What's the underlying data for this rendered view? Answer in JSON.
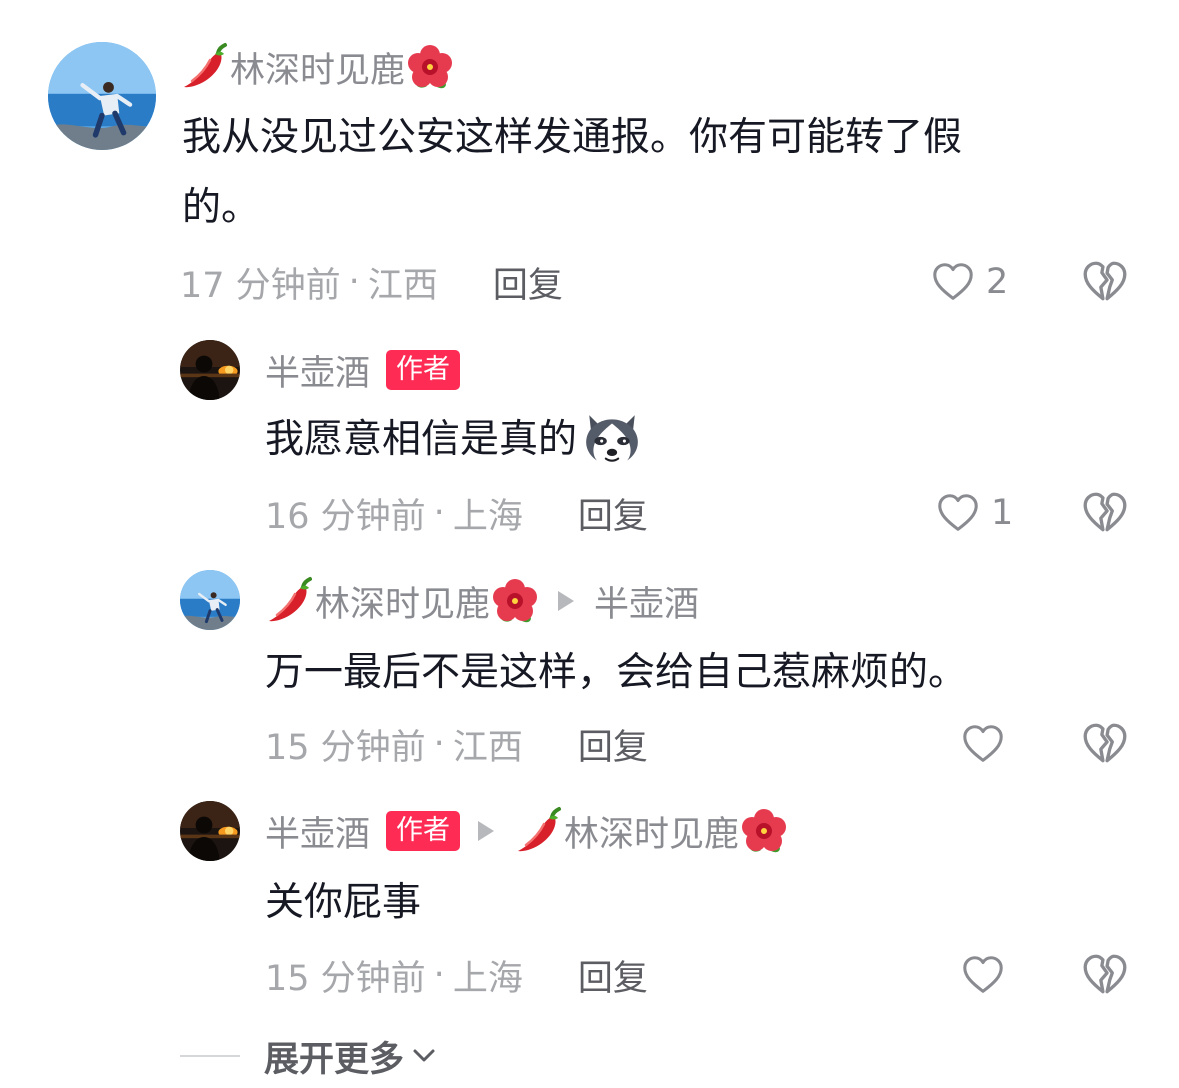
{
  "colors": {
    "accent": "#fe2c55",
    "text_primary": "#161823",
    "text_secondary": "#8a8b91",
    "text_meta": "#a6a7ab",
    "reply": "#5c5d63"
  },
  "comments": [
    {
      "user": "林深时见鹿",
      "prefix_icon": "chili-pepper-emoji-icon",
      "suffix_icon": "hibiscus-flower-emoji-icon",
      "text": "我从没见过公安这样发通报。你有可能转了假\n的。",
      "time": "17 分钟前",
      "location": "江西",
      "reply_label": "回复",
      "likes": "2"
    },
    {
      "user": "半壶酒",
      "author_badge": "作者",
      "text": "我愿意相信是真的",
      "text_suffix_icon": "husky-dog-emoji-icon",
      "time": "16 分钟前",
      "location": "上海",
      "reply_label": "回复",
      "likes": "1"
    },
    {
      "user": "林深时见鹿",
      "prefix_icon": "chili-pepper-emoji-icon",
      "suffix_icon": "hibiscus-flower-emoji-icon",
      "reply_to": "半壶酒",
      "text": "万一最后不是这样，会给自己惹麻烦的。",
      "time": "15 分钟前",
      "location": "江西",
      "reply_label": "回复",
      "likes": ""
    },
    {
      "user": "半壶酒",
      "author_badge": "作者",
      "reply_to": "林深时见鹿",
      "text": "关你屁事",
      "time": "15 分钟前",
      "location": "上海",
      "reply_label": "回复",
      "likes": ""
    }
  ],
  "separator": "·",
  "expand_label": "展开更多"
}
